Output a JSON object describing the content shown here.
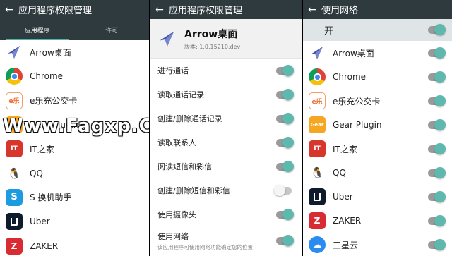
{
  "panel1": {
    "title": "应用程序权限管理",
    "tabs": [
      "应用程序",
      "许可"
    ],
    "apps": [
      "Arrow桌面",
      "Chrome",
      "e乐充公交卡",
      "Gear Plugin",
      "IT之家",
      "QQ",
      "S 换机助手",
      "Uber",
      "ZAKER"
    ]
  },
  "panel2": {
    "title": "应用程序权限管理",
    "app_name": "Arrow桌面",
    "app_version": "版本: 1.0.15210.dev",
    "permissions": [
      {
        "label": "进行通话",
        "on": true
      },
      {
        "label": "读取通话记录",
        "on": true
      },
      {
        "label": "创建/删除通话记录",
        "on": true
      },
      {
        "label": "读取联系人",
        "on": true
      },
      {
        "label": "阅读短信和彩信",
        "on": true
      },
      {
        "label": "创建/删除短信和彩信",
        "on": false
      },
      {
        "label": "使用摄像头",
        "on": true
      },
      {
        "label": "使用网络",
        "on": true
      }
    ],
    "last_desc": "该应用程序可使用网络功能确定您的位置"
  },
  "panel3": {
    "title": "使用网络",
    "master_label": "开",
    "apps": [
      "Arrow桌面",
      "Chrome",
      "e乐充公交卡",
      "Gear Plugin",
      "IT之家",
      "QQ",
      "Uber",
      "ZAKER",
      "三星云"
    ]
  },
  "icon_text": {
    "ele": "e乐",
    "gear": "Gear",
    "ith": "IT",
    "qq": "🐧",
    "s": "S",
    "zaker": "Z",
    "cloud": "☁"
  },
  "watermark": "Www.Fagxp.Com",
  "colors": {
    "header": "#2f3a3f",
    "accent": "#4db6ac",
    "switch_on": "#5fb8ae"
  }
}
